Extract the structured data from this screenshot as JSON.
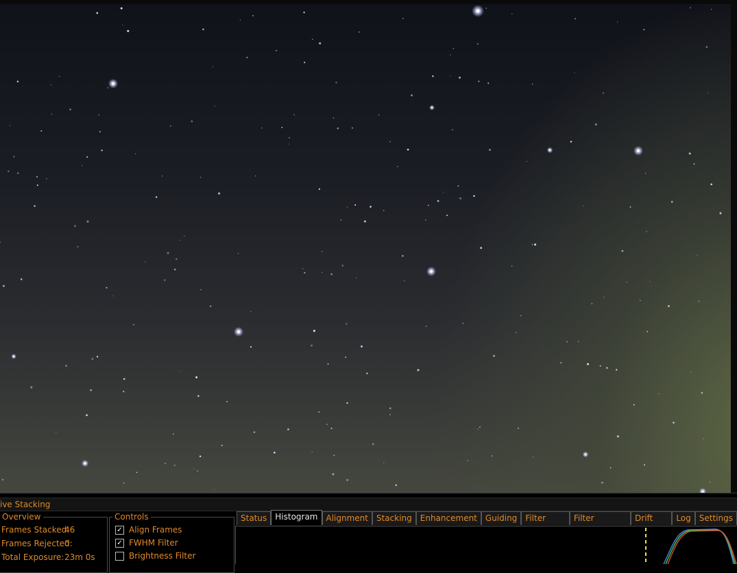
{
  "panel": {
    "title": "ive Stacking"
  },
  "overview": {
    "legend": "Overview",
    "rows": [
      {
        "label": "Frames Stacked:",
        "value": "46"
      },
      {
        "label": "Frames Rejected:",
        "value": "0"
      },
      {
        "label": "Total Exposure:",
        "value": "23m 0s"
      }
    ]
  },
  "controls": {
    "legend": "Controls",
    "items": [
      {
        "label": "Align Frames",
        "checked": true
      },
      {
        "label": "FWHM Filter",
        "checked": true
      },
      {
        "label": "Brightness Filter",
        "checked": false
      }
    ]
  },
  "tabs": [
    {
      "label": "Status",
      "active": false
    },
    {
      "label": "Histogram",
      "active": true
    },
    {
      "label": "Alignment",
      "active": false
    },
    {
      "label": "Stacking",
      "active": false
    },
    {
      "label": "Enhancement",
      "active": false
    },
    {
      "label": "Guiding",
      "active": false
    },
    {
      "label": "Filter (FWHM)",
      "active": false
    },
    {
      "label": "Filter (Brightness)",
      "active": false
    },
    {
      "label": "Drift Graph",
      "active": false
    },
    {
      "label": "Log",
      "active": false
    },
    {
      "label": "Settings",
      "active": false
    }
  ],
  "colors": {
    "accent": "#e08a2a",
    "histogram_red": "#d24a3a",
    "histogram_green": "#4fbf4a",
    "histogram_blue": "#3a7fe0",
    "marker": "#f2e23a"
  }
}
